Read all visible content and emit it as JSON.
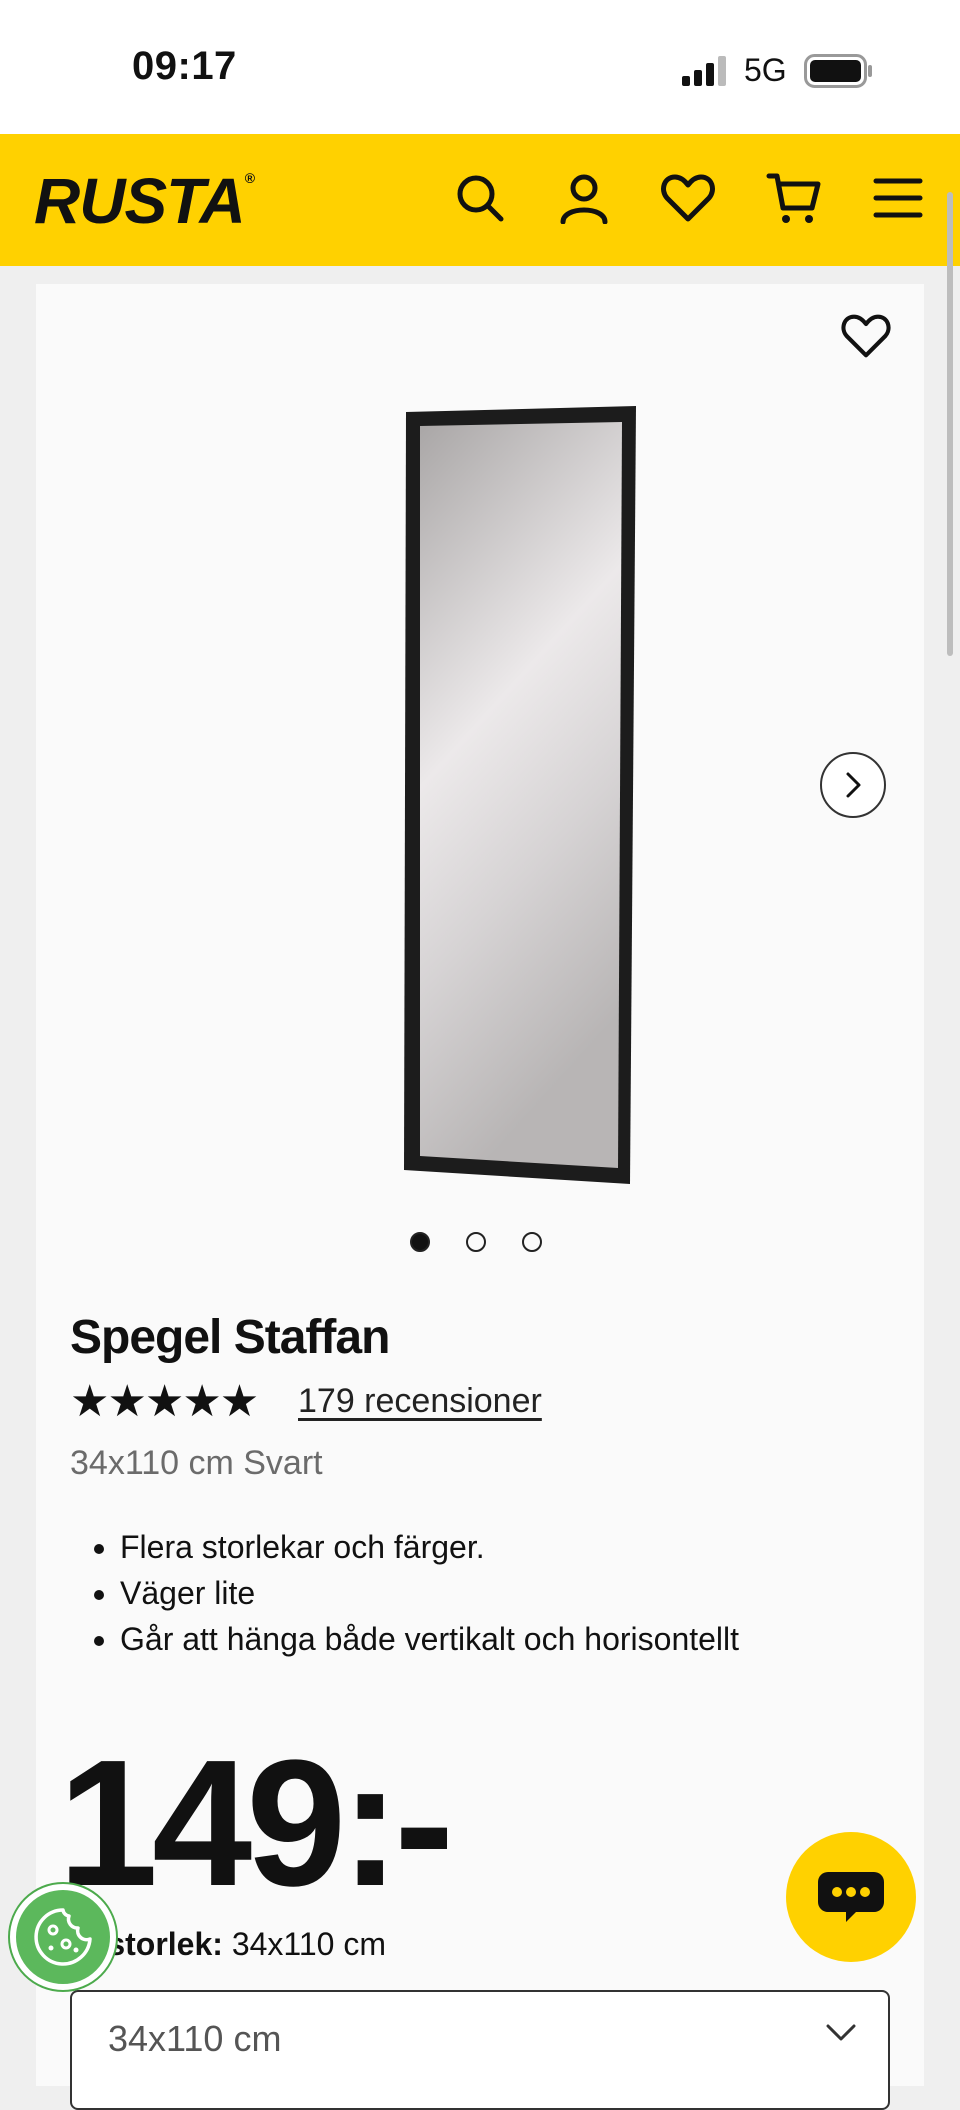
{
  "status_bar": {
    "time": "09:17",
    "network": "5G"
  },
  "header": {
    "logo": "RUSTA",
    "logo_mark": "®"
  },
  "product": {
    "title": "Spegel Staffan",
    "rating_stars": "★★★★★",
    "reviews_text": "179 recensioner",
    "variant": "34x110 cm Svart",
    "features": [
      "Flera storlekar och färger.",
      "Väger lite",
      "Går att hänga både vertikalt och horisontellt"
    ],
    "price": "149:-",
    "size_label_prefix": "ld storlek:",
    "size_label_value": "34x110 cm",
    "size_select_value": "34x110 cm"
  },
  "gallery": {
    "image_count": 3,
    "active_index": 0
  },
  "icons": {
    "search": "search-icon",
    "account": "user-icon",
    "favorites": "heart-icon",
    "cart": "cart-icon",
    "menu": "hamburger-icon",
    "next": "chevron-right-icon",
    "chat": "chat-icon",
    "cookie": "cookie-icon"
  },
  "colors": {
    "brand_yellow": "#ffd100",
    "cookie_green": "#5cb85c"
  }
}
